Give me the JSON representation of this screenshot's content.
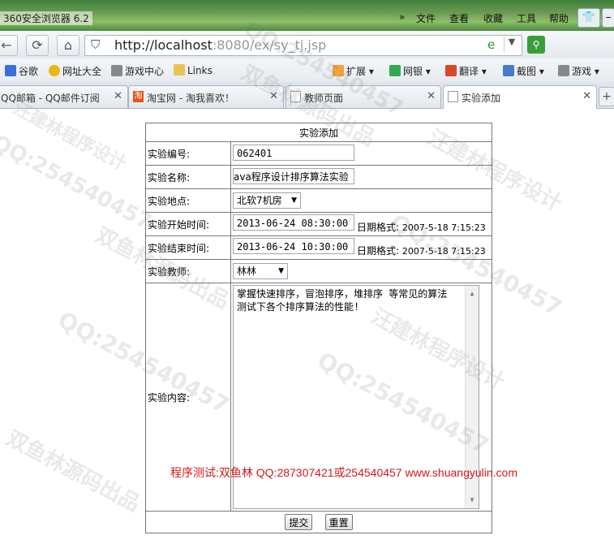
{
  "browser": {
    "title": "360安全浏览器 6.2",
    "menu": [
      "»",
      "文件",
      "查看",
      "收藏",
      "工具",
      "帮助"
    ],
    "url_host": "http://localhost",
    "url_path": ":8080/ex/sy_tj.jsp",
    "favorites": [
      "谷歌",
      "网址大全",
      "游戏中心",
      "Links"
    ],
    "right_tools": [
      "扩展",
      "网银",
      "翻译",
      "截图",
      "游戏"
    ],
    "tabs": [
      {
        "label": "QQ邮箱 - QQ邮件订阅"
      },
      {
        "label": "淘宝网 - 淘我喜欢！"
      },
      {
        "label": "教师页面"
      },
      {
        "label": "实验添加"
      }
    ],
    "new_tab": "+"
  },
  "form": {
    "title": "实验添加",
    "id_label": "实验编号:",
    "id_value": "062401",
    "name_label": "实验名称:",
    "name_value": "ava程序设计排序算法实验",
    "place_label": "实验地点:",
    "place_value": "北软7机房",
    "start_label": "实验开始时间:",
    "start_value": "2013-06-24 08:30:00",
    "end_label": "实验结束时间:",
    "end_value": "2013-06-24 10:30:00",
    "date_hint": "日期格式:",
    "date_example": "2007-5-18 7:15:23",
    "teacher_label": "实验教师:",
    "teacher_value": "林林",
    "content_label": "实验内容:",
    "content_value": "掌握快速排序，冒泡排序，堆排序 等常见的算法 测试下各个排序算法的性能!",
    "submit": "提交",
    "reset": "重置"
  },
  "credit": "程序测试:双鱼林 QQ:287307421或254540457 www.shuangyulin.com",
  "watermarks": [
    "QQ:254540457",
    "双鱼林源码出品",
    "汪建林程序设计"
  ]
}
